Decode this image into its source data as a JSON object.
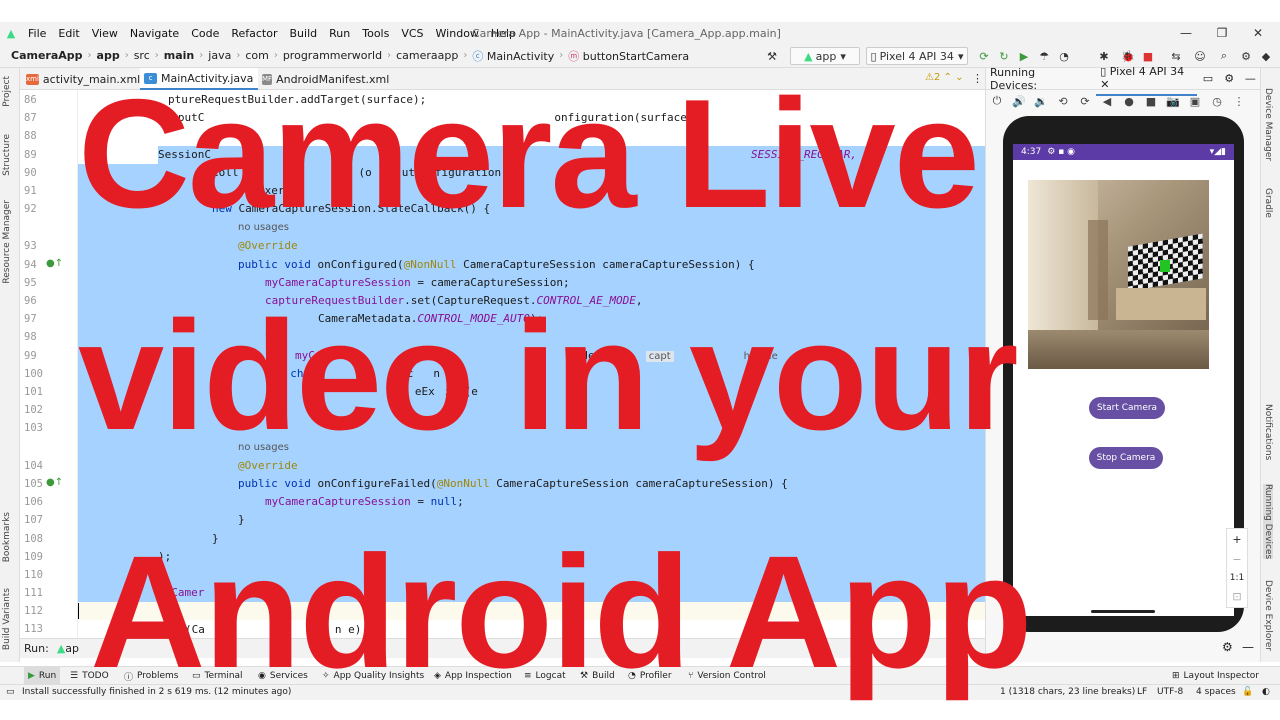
{
  "window": {
    "title": "Camera App - MainActivity.java [Camera_App.app.main]"
  },
  "menu": [
    "File",
    "Edit",
    "View",
    "Navigate",
    "Code",
    "Refactor",
    "Build",
    "Run",
    "Tools",
    "VCS",
    "Window",
    "Help"
  ],
  "breadcrumb": [
    "CameraApp",
    "app",
    "src",
    "main",
    "java",
    "com",
    "programmerworld",
    "cameraapp",
    "MainActivity",
    "buttonStartCamera"
  ],
  "toolbar": {
    "run_config": "app",
    "device": "Pixel 4 API 34"
  },
  "sidebar_left": {
    "project": "Project",
    "structure": "Structure",
    "resource_manager": "Resource Manager",
    "bookmarks": "Bookmarks",
    "build_variants": "Build Variants"
  },
  "sidebar_right": {
    "device_manager": "Device Manager",
    "gradle": "Gradle",
    "notifications": "Notifications",
    "running_devices": "Running Devices",
    "device_explorer": "Device Explorer"
  },
  "tabs": [
    {
      "label": "activity_main.xml",
      "icon": "xml-file-icon"
    },
    {
      "label": "MainActivity.java",
      "icon": "java-class-icon"
    },
    {
      "label": "AndroidManifest.xml",
      "icon": "manifest-file-icon"
    }
  ],
  "editor": {
    "warnings": "2",
    "line_numbers": [
      "86",
      "87",
      "88",
      "89",
      "90",
      "91",
      "92",
      "",
      "93",
      "94",
      "95",
      "96",
      "97",
      "98",
      "99",
      "100",
      "101",
      "102",
      "103",
      "",
      "104",
      "105",
      "106",
      "107",
      "108",
      "109",
      "110",
      "111",
      "112",
      "113"
    ],
    "usage_hint": "no usages",
    "code": {
      "l86": "ptureRequestBuilder.addTarget(surface);",
      "l87": "OutputC",
      "l87b": "onfiguration(surface);",
      "l89": "SessionC",
      "l89b": "SESSION_REGULAR,",
      "l90": "Coll",
      "l90b": "(o",
      "l90c": "utConfiguration),",
      "l91": "Exe",
      "l91b": "r(),",
      "l92a": "new",
      "l92b": " CameraCaptureSession.StateCallback() {",
      "l93": "@Override",
      "l94a": "public void",
      "l94b": " onConfigured(",
      "l94c": "@NonNull",
      "l94d": " CameraCaptureSession cameraCaptureSession) {",
      "l95a": "myCameraCaptureSession",
      "l95b": " = cameraCaptureSession;",
      "l96a": "captureRequestBuilder",
      "l96b": ".set(CaptureRequest.",
      "l96c": "CONTROL_AE_MODE",
      "l96d": ",",
      "l97a": "CameraMetadata.",
      "l97b": "CONTROL_MODE_AUTO",
      "l97c": ");",
      "l98": "tr",
      "l99a": "myCam",
      "l99b": "ewuestB",
      "l99c": "ilder.bui",
      "l99d": "capt",
      "l99e": "handle",
      "l100": "} ",
      "l100b": "ch",
      "l100c": "Exc",
      "l100d": "n e",
      "l101": "row",
      "l101b": "eEx",
      "l101c": "ion(e",
      "l102": "}",
      "l104": "@Override",
      "l105a": "public void",
      "l105b": " onConfigureFailed(",
      "l105c": "@NonNull",
      "l105d": " CameraCaptureSession cameraCaptureSession) {",
      "l106a": "myCameraCaptureSession",
      "l106b": " = ",
      "l106c": "null",
      "l106d": ";",
      "l107": "}",
      "l108": "}",
      "l109": ");",
      "l111a": "myCamer",
      "l111b": "teC",
      "l111c": "on(s",
      "l113": "(Ca",
      "l113b": "n e)"
    }
  },
  "devices": {
    "label": "Running Devices:",
    "device_tab": "Pixel 4 API 34"
  },
  "phone": {
    "time": "4:37",
    "start_button": "Start Camera",
    "stop_button": "Stop Camera"
  },
  "zoom": {
    "plus": "+",
    "minus": "−",
    "one_to_one": "1:1"
  },
  "run_panel": {
    "label": "Run:",
    "config": "ap"
  },
  "bottom_tools": [
    "Run",
    "TODO",
    "Problems",
    "Terminal",
    "Services",
    "App Quality Insights",
    "App Inspection",
    "Logcat",
    "Build",
    "Profiler",
    "Version Control",
    "Layout Inspector"
  ],
  "status": {
    "message": "Install successfully finished in 2 s 619 ms. (12 minutes ago)",
    "selection": "1 (1318 chars, 23 line breaks)",
    "line_ending": "LF",
    "encoding": "UTF-8",
    "indent": "4 spaces"
  },
  "overlay": {
    "line1": "Camera Live",
    "line2": "video in your",
    "line3": "Android App",
    "color": "#e41c24"
  }
}
